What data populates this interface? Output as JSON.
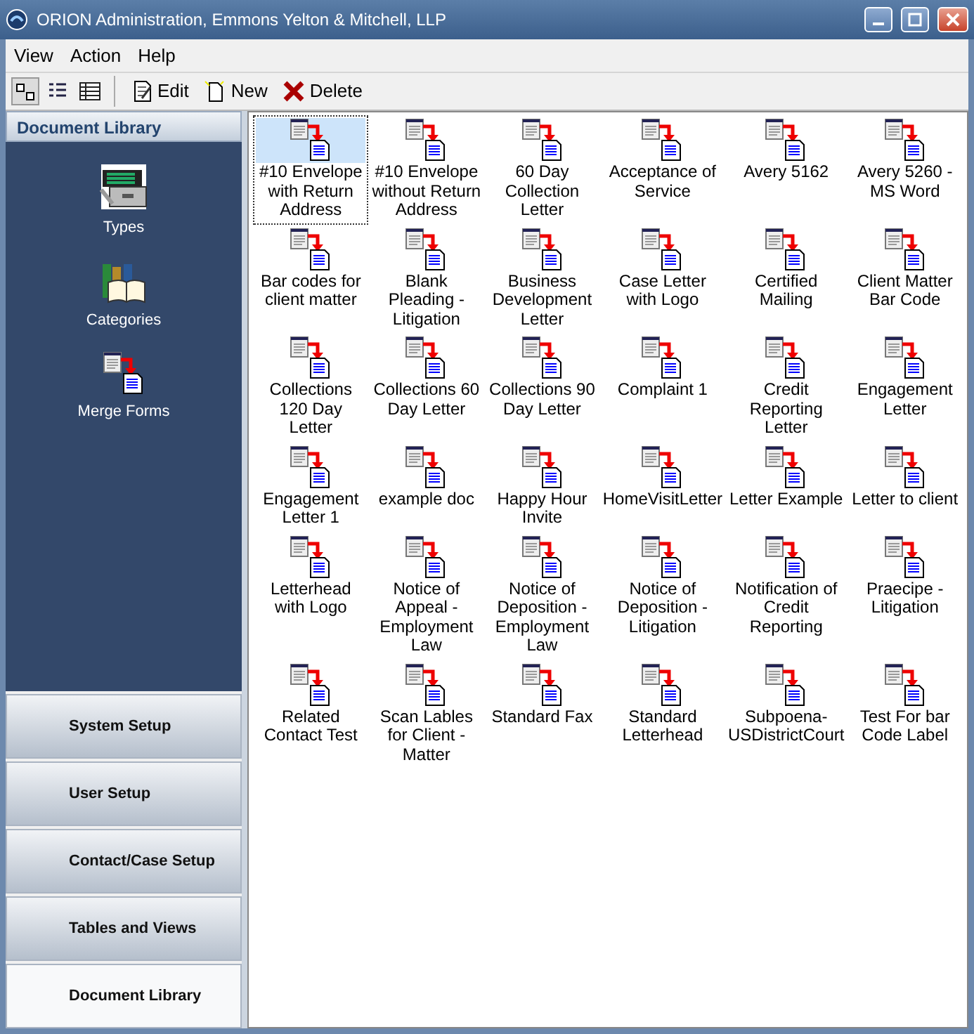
{
  "window": {
    "title": "ORION Administration, Emmons Yelton & Mitchell, LLP"
  },
  "menu": [
    "View",
    "Action",
    "Help"
  ],
  "toolbar": {
    "views": [
      {
        "kind": "large-icons",
        "selected": true
      },
      {
        "kind": "list",
        "selected": false
      },
      {
        "kind": "details",
        "selected": false
      }
    ],
    "actions": [
      {
        "kind": "edit",
        "label": "Edit"
      },
      {
        "kind": "new",
        "label": "New"
      },
      {
        "kind": "delete",
        "label": "Delete"
      }
    ]
  },
  "sidebar": {
    "header": "Document Library",
    "items": [
      {
        "kind": "types",
        "label": "Types"
      },
      {
        "kind": "categories",
        "label": "Categories"
      },
      {
        "kind": "merge",
        "label": "Merge Forms"
      }
    ],
    "sections": [
      {
        "label": "System Setup",
        "selected": false
      },
      {
        "label": "User Setup",
        "selected": false
      },
      {
        "label": "Contact/Case Setup",
        "selected": false
      },
      {
        "label": "Tables and Views",
        "selected": false
      },
      {
        "label": "Document Library",
        "selected": true
      }
    ]
  },
  "documents": [
    {
      "label": "#10 Envelope with Return Address",
      "selected": true
    },
    {
      "label": "#10 Envelope without Return Address",
      "selected": false
    },
    {
      "label": "60 Day Collection Letter",
      "selected": false
    },
    {
      "label": "Acceptance of Service",
      "selected": false
    },
    {
      "label": "Avery 5162",
      "selected": false
    },
    {
      "label": "Avery 5260 - MS Word",
      "selected": false
    },
    {
      "label": "Bar codes for client matter",
      "selected": false
    },
    {
      "label": "Blank Pleading - Litigation",
      "selected": false
    },
    {
      "label": "Business Development Letter",
      "selected": false
    },
    {
      "label": "Case Letter with Logo",
      "selected": false
    },
    {
      "label": "Certified Mailing",
      "selected": false
    },
    {
      "label": "Client Matter Bar Code",
      "selected": false
    },
    {
      "label": "Collections 120 Day Letter",
      "selected": false
    },
    {
      "label": "Collections 60 Day Letter",
      "selected": false
    },
    {
      "label": "Collections 90 Day Letter",
      "selected": false
    },
    {
      "label": "Complaint 1",
      "selected": false
    },
    {
      "label": "Credit Reporting Letter",
      "selected": false
    },
    {
      "label": "Engagement Letter",
      "selected": false
    },
    {
      "label": "Engagement Letter 1",
      "selected": false
    },
    {
      "label": "example doc",
      "selected": false
    },
    {
      "label": "Happy Hour Invite",
      "selected": false
    },
    {
      "label": "HomeVisitLetter",
      "selected": false
    },
    {
      "label": "Letter Example",
      "selected": false
    },
    {
      "label": "Letter to client",
      "selected": false
    },
    {
      "label": "Letterhead with Logo",
      "selected": false
    },
    {
      "label": "Notice of Appeal - Employment Law",
      "selected": false
    },
    {
      "label": "Notice of Deposition - Employment Law",
      "selected": false
    },
    {
      "label": "Notice of Deposition - Litigation",
      "selected": false
    },
    {
      "label": "Notification of Credit Reporting",
      "selected": false
    },
    {
      "label": "Praecipe - Litigation",
      "selected": false
    },
    {
      "label": "Related Contact Test",
      "selected": false
    },
    {
      "label": "Scan Lables for Client - Matter",
      "selected": false
    },
    {
      "label": "Standard Fax",
      "selected": false
    },
    {
      "label": "Standard Letterhead",
      "selected": false
    },
    {
      "label": "Subpoena-USDistrictCourt",
      "selected": false
    },
    {
      "label": "Test For bar Code Label",
      "selected": false
    }
  ]
}
